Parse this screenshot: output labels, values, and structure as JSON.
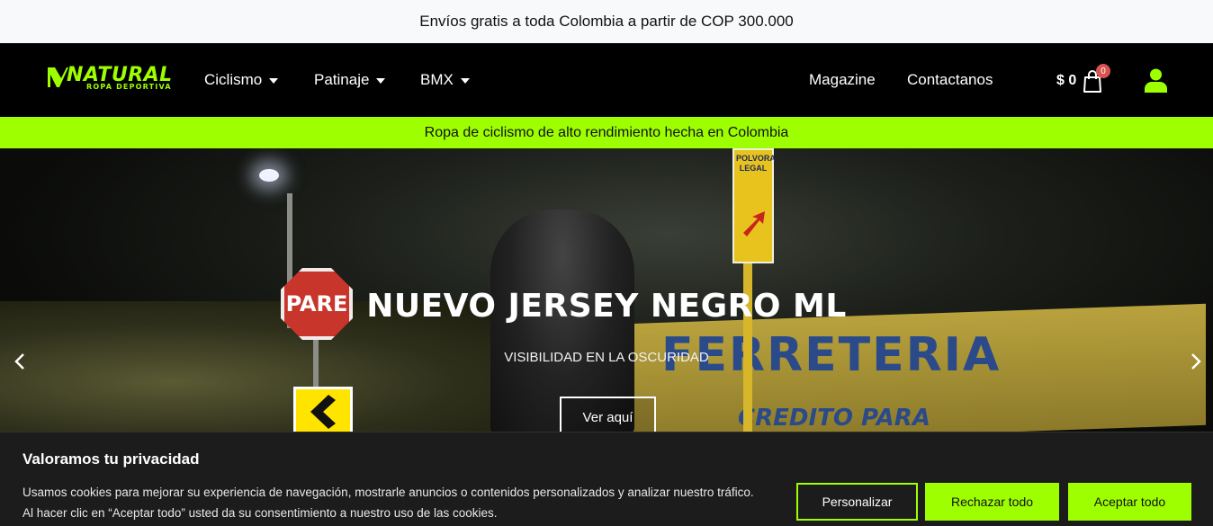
{
  "announcement": "Envíos gratis a toda Colombia a partir de COP 300.000",
  "header": {
    "logo_word": "NATURAL",
    "logo_tagline": "ROPA DEPORTIVA",
    "nav_left": [
      {
        "label": "Ciclismo"
      },
      {
        "label": "Patinaje"
      },
      {
        "label": "BMX"
      }
    ],
    "nav_right": [
      {
        "label": "Magazine"
      },
      {
        "label": "Contactanos"
      }
    ],
    "cart_amount": "$ 0",
    "cart_count": "0",
    "accent_color": "#9eff00"
  },
  "promo_strip": "Ropa de ciclismo de alto rendimiento hecha en Colombia",
  "hero": {
    "title": "NUEVO JERSEY NEGRO ML",
    "subtitle": "VISIBILIDAD EN LA OSCURIDAD",
    "button_label": "Ver aquí",
    "scene": {
      "stop_sign": "PARE",
      "road_sign": "POLVORA LEGAL",
      "wall_text": "FERRETERIA",
      "wall_text_2": "CREDITO PARA"
    }
  },
  "cookie_banner": {
    "title": "Valoramos tu privacidad",
    "text_line1": "Usamos cookies para mejorar su experiencia de navegación, mostrarle anuncios o contenidos personalizados y analizar nuestro tráfico.",
    "text_line2": "Al hacer clic en “Aceptar todo” usted da su consentimiento a nuestro uso de las cookies.",
    "customize_label": "Personalizar",
    "reject_label": "Rechazar todo",
    "accept_label": "Aceptar todo"
  }
}
